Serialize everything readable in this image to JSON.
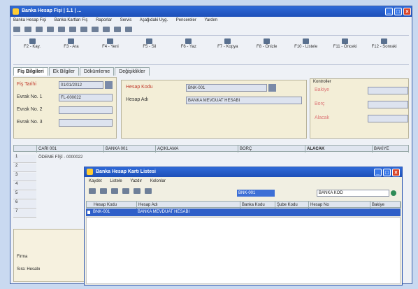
{
  "main_window": {
    "title": "Banka Hesap Fişi | 1.1 | ...",
    "menu": [
      "Banka Hesap Fişi",
      "Banka Kartları Fiş",
      "Raporlar",
      "Servis",
      "Aşağıdaki Uyg.",
      "Pencereler",
      "Yardım"
    ],
    "toolbar": [
      {
        "label": "F2 - Kay.",
        "icon": "save-icon"
      },
      {
        "label": "F3 - Ara",
        "icon": "search-icon"
      },
      {
        "label": "F4 - Yeni",
        "icon": "new-icon"
      },
      {
        "label": "F5 - Sil",
        "icon": "delete-icon"
      },
      {
        "label": "F6 - Yaz",
        "icon": "print-icon"
      },
      {
        "label": "F7 - Kopya",
        "icon": "copy-icon"
      },
      {
        "label": "F8 - Önizle",
        "icon": "preview-icon"
      },
      {
        "label": "F10 - Listele",
        "icon": "list-icon"
      },
      {
        "label": "F11 - Önceki",
        "icon": "prev-icon"
      },
      {
        "label": "F12 - Sonraki",
        "icon": "next-icon"
      }
    ],
    "tabs": [
      "Fiş Bilgileri",
      "Ek Bilgiler",
      "Dökümleme",
      "Değişiklikler"
    ],
    "left_fields": {
      "fis_tarihi_label": "Fiş Tarihi",
      "fis_tarihi_value": "01/01/2012",
      "evrak_no_label": "Evrak No. 1",
      "evrak_no_value": "FL-000022",
      "evrak_no2_label": "Evrak No. 2",
      "evrak_no3_label": "Evrak No. 3"
    },
    "mid_fields": {
      "hesap_kodu_label": "Hesap Kodu",
      "hesap_kodu_value": "BNK-001",
      "hesap_adi_label": "Hesap Adı",
      "hesap_adi_value": "BANKA MEVDUAT HESABI"
    },
    "right_panel": {
      "title": "Kontroller",
      "rows": [
        "Bakiye",
        "Borç",
        "Alacak"
      ]
    },
    "grid_header": [
      "CARİ 001",
      "BANKA 001",
      "AÇIKLAMA",
      "BORÇ",
      "ALACAK",
      "BAKİYE"
    ],
    "grid_first_row": "ÖDEME FİŞİ - 0000022",
    "row_numbers": [
      "1",
      "2",
      "3",
      "4",
      "5",
      "6",
      "7"
    ]
  },
  "popup_window": {
    "title": "Banka Hesap Kartı Listesi",
    "menu": [
      "Kaydet",
      "Listele",
      "Yazdır",
      "Kolonlar"
    ],
    "filter_value": "BNK-001",
    "filter_select": "BANKA KOD",
    "columns": [
      "Hesap Kodu",
      "Hesap Adı",
      "Banka Kodu",
      "Şube Kodu",
      "Hesap No",
      "Bakiye"
    ],
    "selected_row": [
      "BNK-001",
      "BANKA MEVDUAT HESABI",
      "",
      "",
      "",
      ""
    ]
  },
  "bottom_left": {
    "fields": [
      "Firma",
      "Sıra: Hesabı"
    ]
  }
}
